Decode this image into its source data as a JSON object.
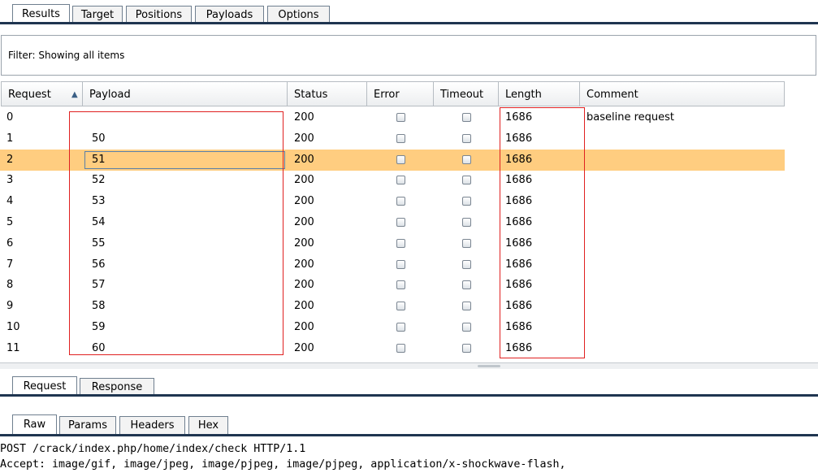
{
  "top_tabs": [
    "Results",
    "Target",
    "Positions",
    "Payloads",
    "Options"
  ],
  "filter_text": "Filter: Showing all items",
  "columns": [
    "Request",
    "Payload",
    "Status",
    "Error",
    "Timeout",
    "Length",
    "Comment"
  ],
  "rows": [
    {
      "request": "0",
      "payload": "",
      "status": "200",
      "error": false,
      "timeout": false,
      "length": "1686",
      "comment": "baseline request"
    },
    {
      "request": "1",
      "payload": "50",
      "status": "200",
      "error": false,
      "timeout": false,
      "length": "1686",
      "comment": ""
    },
    {
      "request": "2",
      "payload": "51",
      "status": "200",
      "error": false,
      "timeout": false,
      "length": "1686",
      "comment": ""
    },
    {
      "request": "3",
      "payload": "52",
      "status": "200",
      "error": false,
      "timeout": false,
      "length": "1686",
      "comment": ""
    },
    {
      "request": "4",
      "payload": "53",
      "status": "200",
      "error": false,
      "timeout": false,
      "length": "1686",
      "comment": ""
    },
    {
      "request": "5",
      "payload": "54",
      "status": "200",
      "error": false,
      "timeout": false,
      "length": "1686",
      "comment": ""
    },
    {
      "request": "6",
      "payload": "55",
      "status": "200",
      "error": false,
      "timeout": false,
      "length": "1686",
      "comment": ""
    },
    {
      "request": "7",
      "payload": "56",
      "status": "200",
      "error": false,
      "timeout": false,
      "length": "1686",
      "comment": ""
    },
    {
      "request": "8",
      "payload": "57",
      "status": "200",
      "error": false,
      "timeout": false,
      "length": "1686",
      "comment": ""
    },
    {
      "request": "9",
      "payload": "58",
      "status": "200",
      "error": false,
      "timeout": false,
      "length": "1686",
      "comment": ""
    },
    {
      "request": "10",
      "payload": "59",
      "status": "200",
      "error": false,
      "timeout": false,
      "length": "1686",
      "comment": ""
    },
    {
      "request": "11",
      "payload": "60",
      "status": "200",
      "error": false,
      "timeout": false,
      "length": "1686",
      "comment": ""
    }
  ],
  "selected_row": "2",
  "sort_icon": "sort-ascending-icon",
  "colors": {
    "selected_row": "#ffcd80",
    "highlight_box": "#e02020",
    "tab_line": "#1f3550"
  },
  "reqres_tabs": [
    "Request",
    "Response"
  ],
  "view_tabs": [
    "Raw",
    "Params",
    "Headers",
    "Hex"
  ],
  "raw_lines": [
    "POST /crack/index.php/home/index/check HTTP/1.1",
    "Accept: image/gif, image/jpeg, image/pjpeg, image/pjpeg, application/x-shockwave-flash,"
  ]
}
